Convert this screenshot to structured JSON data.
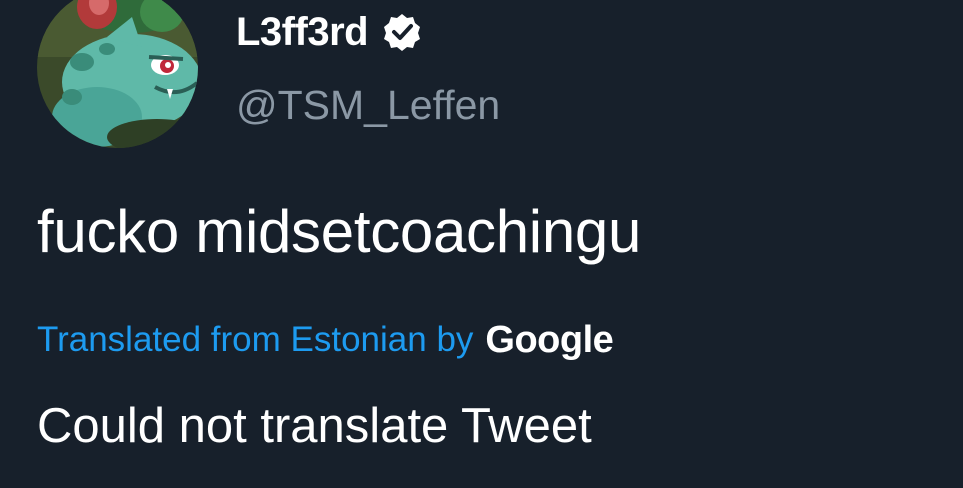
{
  "author": {
    "display_name": "L3ff3rd",
    "handle": "@TSM_Leffen",
    "verified": true,
    "avatar_icon": "bulbasaur-avatar"
  },
  "tweet": {
    "text": "fucko midsetcoachingu"
  },
  "translation": {
    "label": "Translated from Estonian by",
    "provider": "Google",
    "result": "Could not translate Tweet"
  },
  "colors": {
    "background": "#17202b",
    "link": "#1d9bf0",
    "secondary_text": "#8b98a5",
    "primary_text": "#ffffff"
  }
}
